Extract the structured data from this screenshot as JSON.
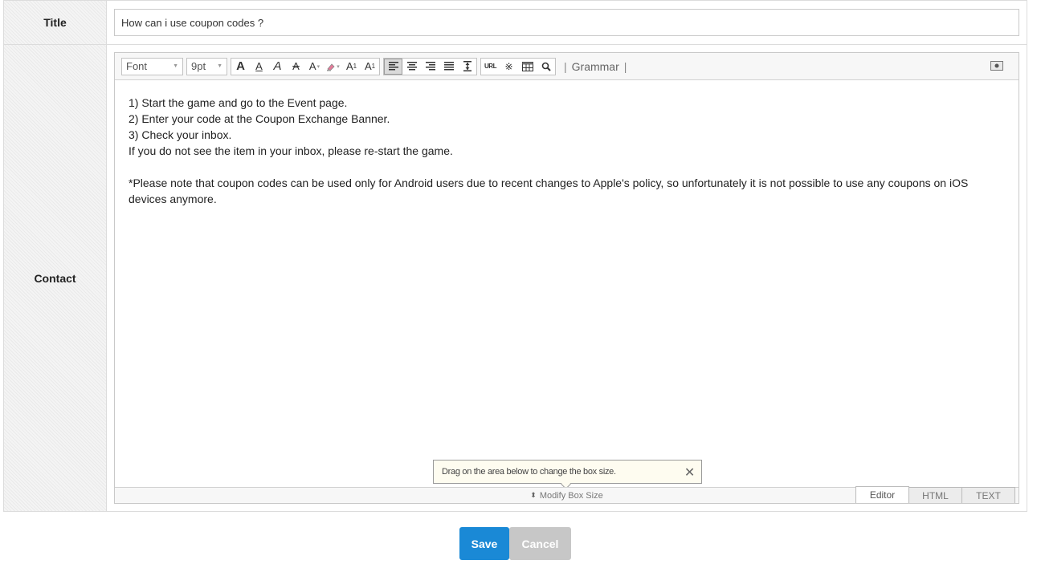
{
  "form": {
    "title_label": "Title",
    "title_value": "How can i use coupon codes ?",
    "contact_label": "Contact"
  },
  "toolbar": {
    "font_select": "Font",
    "size_select": "9pt",
    "style_buttons": [
      "A",
      "A",
      "A",
      "A",
      "A"
    ],
    "superscript_label": "A",
    "superscript_mark": "1",
    "subscript_label": "A",
    "subscript_mark": "1",
    "url_label": "URL",
    "special_char_label": "※",
    "grammar_label": "Grammar",
    "separator": "|"
  },
  "content": {
    "lines": [
      "1) Start the game and go to the Event page.",
      "2) Enter your code at the Coupon Exchange Banner.",
      "3) Check your inbox.",
      "If you do not see the item in your inbox, please re-start the game.",
      "",
      "*Please note that coupon codes can be used only for Android users due to recent changes to Apple's policy, so unfortunately it is not possible to use any coupons on iOS devices anymore."
    ]
  },
  "tooltip": {
    "text": "Drag on the area below to change the box size.",
    "close": "✕"
  },
  "resize": {
    "arrow": "⬍",
    "label": "Modify Box Size"
  },
  "modes": {
    "editor": "Editor",
    "html": "HTML",
    "text": "TEXT"
  },
  "actions": {
    "save": "Save",
    "cancel": "Cancel"
  },
  "colors": {
    "save_button": "#1a89d6",
    "cancel_button": "#c7c7c7"
  }
}
